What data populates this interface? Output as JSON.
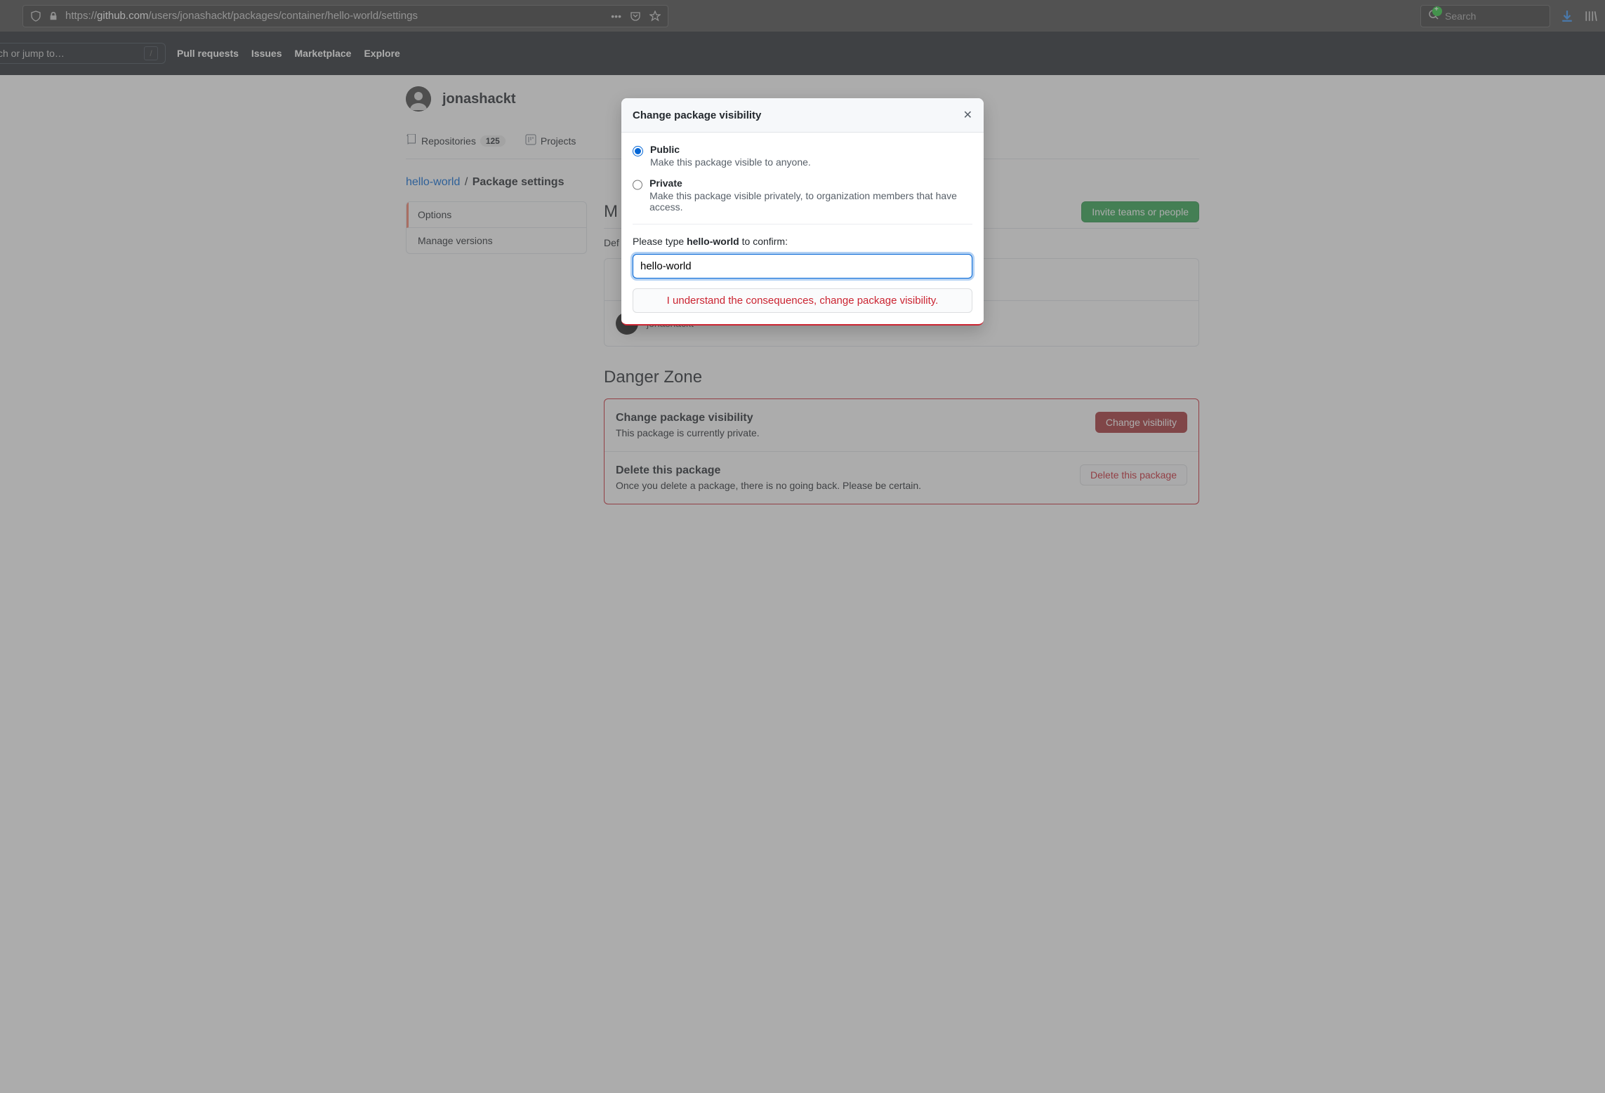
{
  "browser": {
    "url_prefix": "https://",
    "url_domain": "github.com",
    "url_path": "/users/jonashackt/packages/container/hello-world/settings",
    "search_placeholder": "Search"
  },
  "gh_header": {
    "search_placeholder": "ch or jump to…",
    "nav": [
      "Pull requests",
      "Issues",
      "Marketplace",
      "Explore"
    ]
  },
  "profile": {
    "username": "jonashackt",
    "tabs": {
      "repos_label": "Repositories",
      "repos_count": "125",
      "projects_label": "Projects"
    }
  },
  "breadcrumb": {
    "link": "hello-world",
    "sep": "/",
    "current": "Package settings"
  },
  "sidebar": {
    "options": "Options",
    "manage_versions": "Manage versions"
  },
  "main": {
    "manage_title_partial": "M",
    "invite_button": "Invite teams or people",
    "def_partial": "Def",
    "username_row": "jonashackt"
  },
  "danger": {
    "heading": "Danger Zone",
    "visibility_title": "Change package visibility",
    "visibility_desc": "This package is currently private.",
    "visibility_btn": "Change visibility",
    "delete_title": "Delete this package",
    "delete_desc": "Once you delete a package, there is no going back. Please be certain.",
    "delete_btn": "Delete this package"
  },
  "modal": {
    "title": "Change package visibility",
    "public_label": "Public",
    "public_desc": "Make this package visible to anyone.",
    "private_label": "Private",
    "private_desc": "Make this package visible privately, to organization members that have access.",
    "confirm_prefix": "Please type ",
    "confirm_name": "hello-world",
    "confirm_suffix": " to confirm:",
    "input_value": "hello-world",
    "confirm_btn": "I understand the consequences, change package visibility."
  }
}
